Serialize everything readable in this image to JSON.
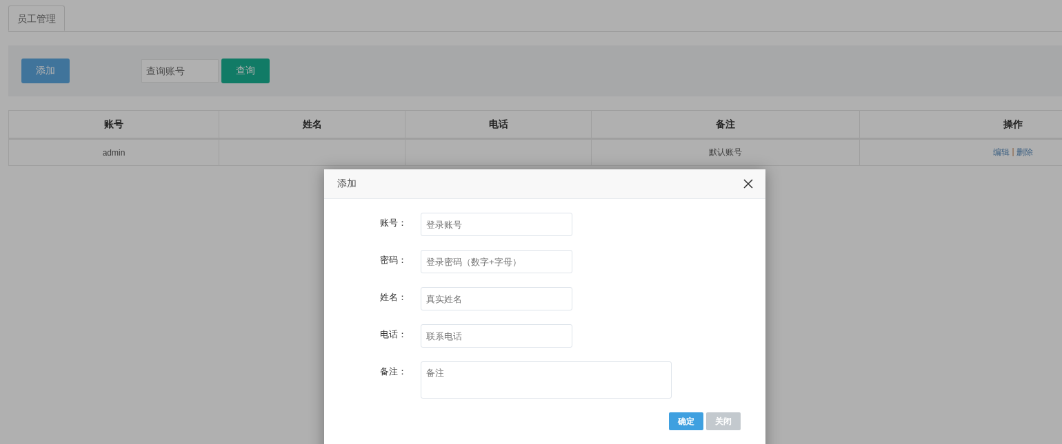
{
  "tabs": [
    {
      "label": "员工管理",
      "selected": true
    }
  ],
  "toolbar": {
    "add_button": "添加",
    "search": {
      "placeholder": "查询账号"
    },
    "search_button": "查询"
  },
  "table": {
    "columns": [
      "账号",
      "姓名",
      "电话",
      "备注",
      "操作"
    ],
    "rows": [
      {
        "account": "admin",
        "note": "默认账号",
        "actions": [
          "编辑",
          "删除"
        ],
        "separator": "|"
      }
    ]
  },
  "dialog": {
    "title": "添加",
    "fields": [
      {
        "label": "账号：",
        "placeholder": "登录账号",
        "kind": "input"
      },
      {
        "label": "密码：",
        "placeholder": "登录密码（数字+字母）",
        "kind": "input"
      },
      {
        "label": "姓名：",
        "placeholder": "真实姓名",
        "kind": "input"
      },
      {
        "label": "电话：",
        "placeholder": "联系电话",
        "kind": "input"
      },
      {
        "label": "备注：",
        "placeholder": "备注",
        "kind": "textarea"
      }
    ],
    "buttons": [
      {
        "label": "确定",
        "kind": "primary"
      },
      {
        "label": "关闭",
        "kind": "secondary"
      }
    ]
  }
}
